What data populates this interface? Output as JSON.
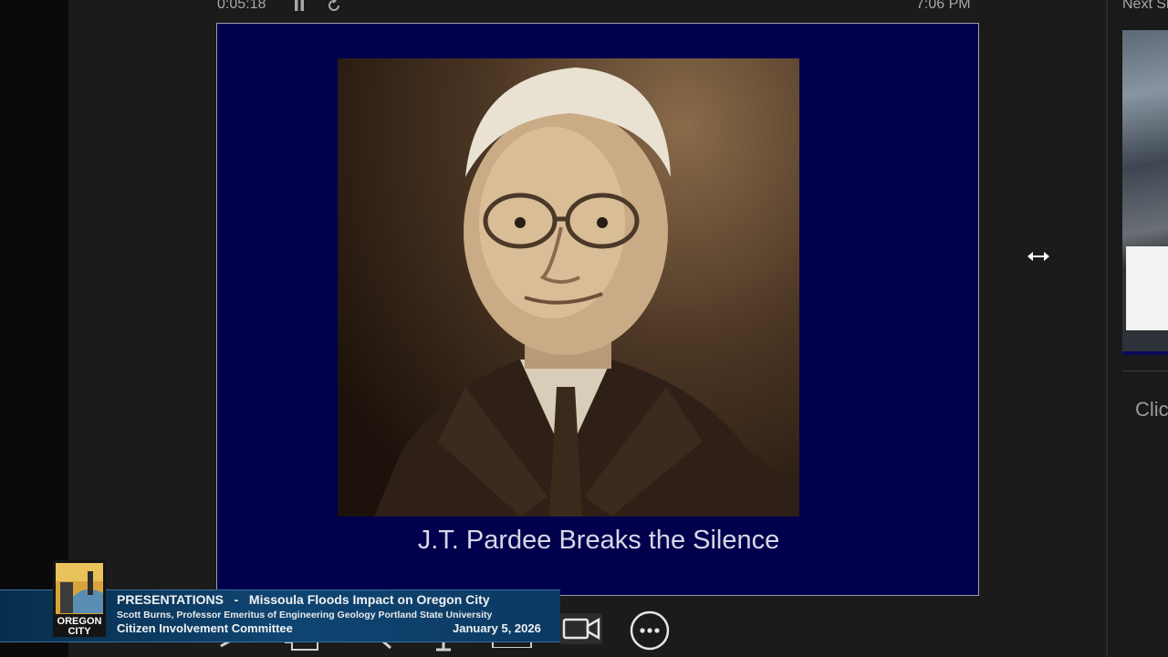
{
  "presenter": {
    "elapsed_time": "0:05:18",
    "clock": "7:06 PM",
    "next_slide_label": "Next Slide",
    "notes_placeholder": "Click to add notes"
  },
  "slide": {
    "title": "J.T. Pardee Breaks the Silence",
    "image": "sepia-portrait-of-man-in-suit-and-glasses"
  },
  "lower_third": {
    "heading": "PRESENTATIONS   -   Missoula Floods Impact on Oregon City",
    "speaker": "Scott Burns, Professor Emeritus of Engineering Geology Portland State University",
    "committee": "Citizen Involvement Committee",
    "date": "January 5, 2026",
    "logo_text": "OREGON CITY"
  },
  "colors": {
    "slide_background": "#00004c",
    "lower_third_bar": "#0f4572",
    "page_background": "#1b1b1b"
  },
  "icons": [
    "pause-icon",
    "restart-icon",
    "resize-arrows-icon",
    "pen-icon",
    "slides-grid-icon",
    "zoom-icon",
    "pointer-icon",
    "subtitles-icon",
    "camera-icon",
    "more-options-icon"
  ]
}
